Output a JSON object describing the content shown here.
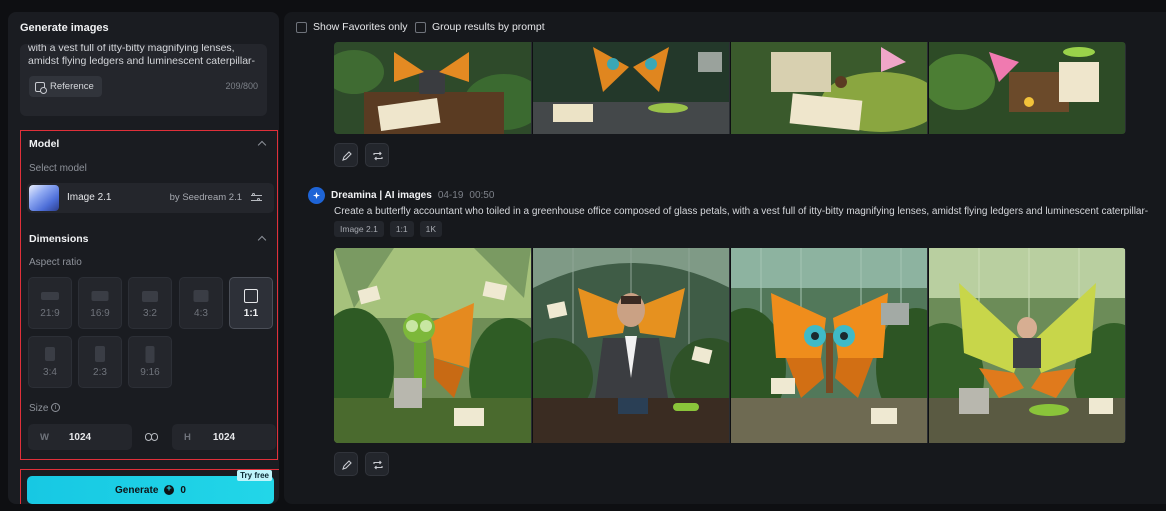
{
  "left_panel": {
    "title": "Generate images",
    "prompt": "with a vest full of itty-bitty magnifying lenses, amidst flying ledgers and luminescent caterpillar-",
    "reference_label": "Reference",
    "char_count": "209/800",
    "model_section": {
      "title": "Model",
      "select_label": "Select model",
      "model_name": "Image 2.1",
      "model_by": "by Seedream 2.1"
    },
    "dimensions_section": {
      "title": "Dimensions",
      "aspect_label": "Aspect ratio",
      "ratios": [
        {
          "label": "21:9",
          "active": false
        },
        {
          "label": "16:9",
          "active": false
        },
        {
          "label": "3:2",
          "active": false
        },
        {
          "label": "4:3",
          "active": false
        },
        {
          "label": "1:1",
          "active": true
        },
        {
          "label": "3:4",
          "active": false
        },
        {
          "label": "2:3",
          "active": false
        },
        {
          "label": "9:16",
          "active": false
        }
      ],
      "size_label": "Size",
      "width_prefix": "W",
      "width_value": "1024",
      "height_prefix": "H",
      "height_value": "1024"
    },
    "generate": {
      "label": "Generate",
      "cost": "0",
      "badge": "Try free"
    }
  },
  "main": {
    "filters": {
      "favorites_label": "Show Favorites only",
      "group_label": "Group results by prompt"
    },
    "result": {
      "author": "Dreamina | AI images",
      "date": "04-19",
      "time": "00:50",
      "prompt": "Create a butterfly accountant who toiled in a greenhouse office composed of glass petals, with a vest full of itty-bitty magnifying lenses, amidst flying ledgers and luminescent caterpillar-",
      "tags": [
        "Image 2.1",
        "1:1",
        "1K"
      ]
    }
  },
  "colors": {
    "accent_cyan": "#22d6e8",
    "highlight_red": "#e0303a",
    "brand_blue": "#1e64d6"
  }
}
